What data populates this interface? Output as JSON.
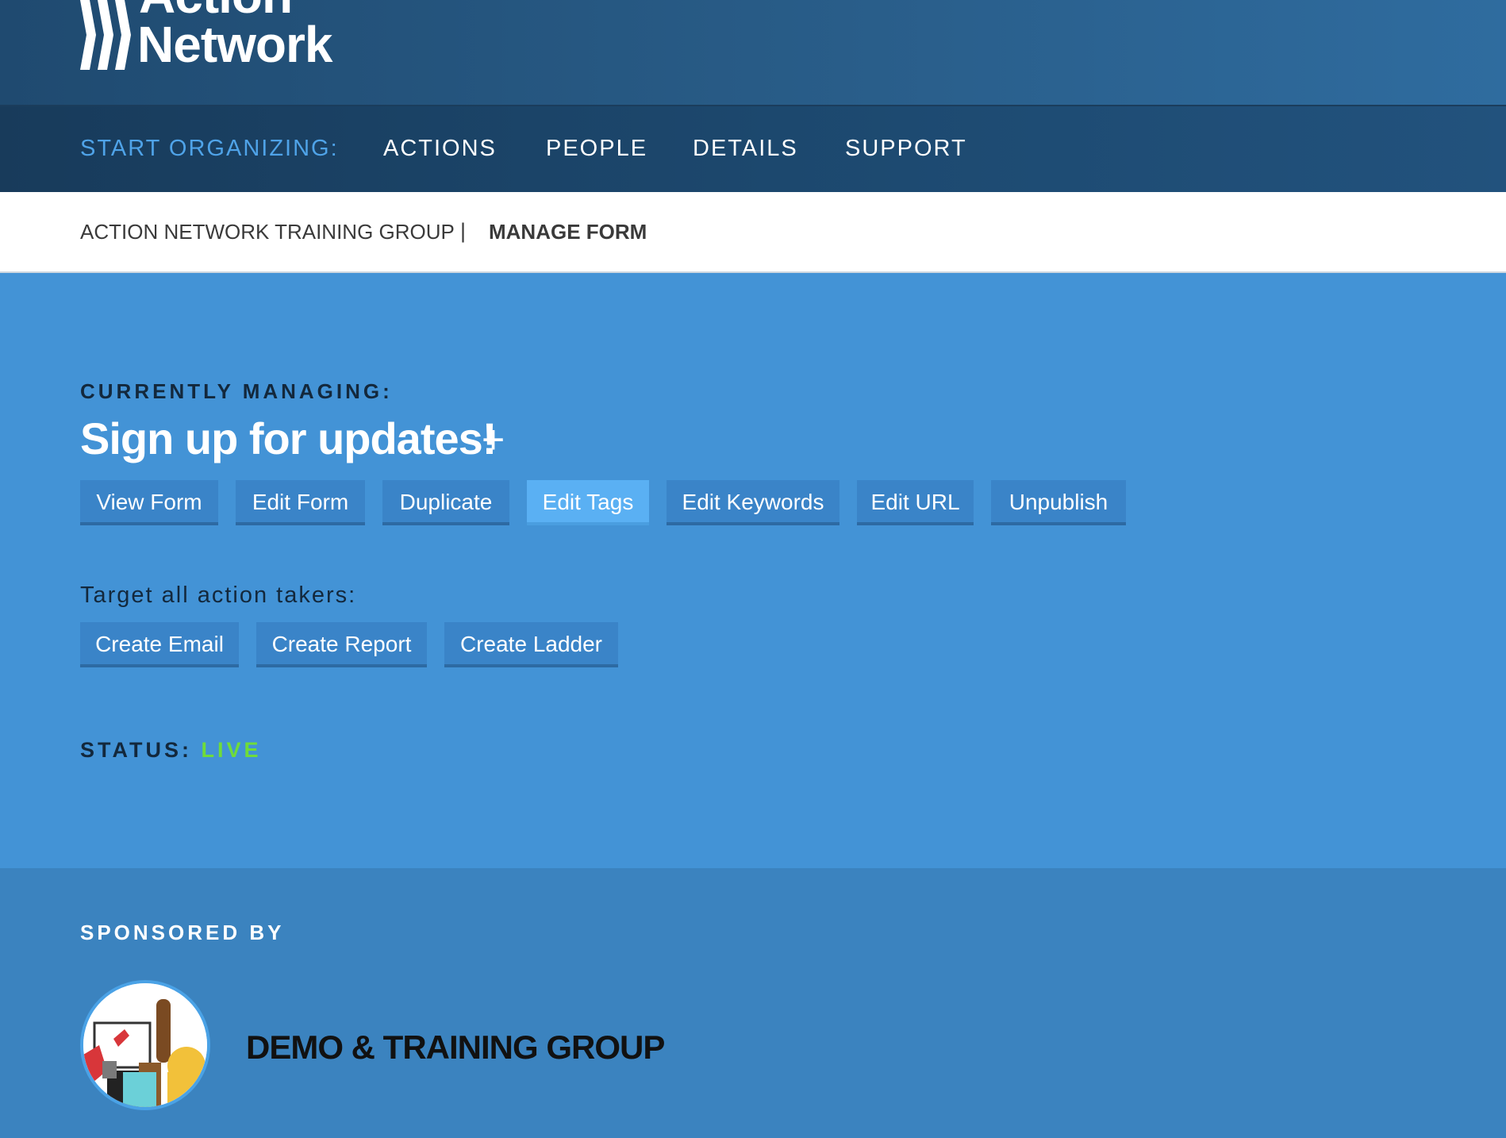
{
  "header": {
    "logo_line1": "Action",
    "logo_line2": "Network"
  },
  "nav": {
    "prompt": "START ORGANIZING:",
    "items": [
      "ACTIONS",
      "PEOPLE",
      "DETAILS",
      "SUPPORT"
    ]
  },
  "breadcrumb": {
    "group": "ACTION NETWORK TRAINING GROUP",
    "separator": "|",
    "current": "MANAGE FORM"
  },
  "main": {
    "managing_label": "CURRENTLY MANAGING:",
    "form_title": "Sign up for updates!",
    "plus": "+",
    "actions": [
      "View Form",
      "Edit Form",
      "Duplicate",
      "Edit Tags",
      "Edit Keywords",
      "Edit URL",
      "Unpublish"
    ],
    "active_action": "Edit Tags",
    "target_label": "Target all action takers:",
    "target_actions": [
      "Create Email",
      "Create Report",
      "Create Ladder"
    ],
    "status_label": "STATUS:",
    "status_value": "LIVE"
  },
  "sponsor": {
    "label": "SPONSORED BY",
    "name": "DEMO & TRAINING GROUP"
  },
  "colors": {
    "nav_prompt": "#4fa3e8",
    "main_bg": "#4393d6",
    "button_bg": "#3a84c8",
    "button_active_bg": "#5ab0f3",
    "status_live": "#6fdc3a"
  }
}
